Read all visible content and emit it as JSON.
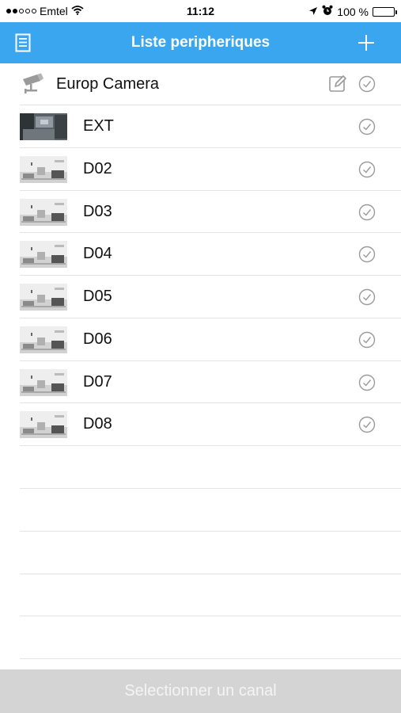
{
  "status_bar": {
    "carrier": "Emtel",
    "time": "11:12",
    "battery": "100 %",
    "signal_bars_filled": 2,
    "signal_bars_total": 5
  },
  "nav": {
    "title": "Liste peripheriques",
    "left_icon": "list-document-icon",
    "right_icon": "plus-icon",
    "color": "#3aa6f0"
  },
  "device": {
    "name": "Europ Camera",
    "icon": "cctv-camera-icon",
    "edit_icon": "edit-pencil-icon",
    "check_icon": "check-circle-icon"
  },
  "channels": [
    {
      "label": "EXT",
      "thumb": "dark"
    },
    {
      "label": "D02",
      "thumb": "light"
    },
    {
      "label": "D03",
      "thumb": "light"
    },
    {
      "label": "D04",
      "thumb": "light"
    },
    {
      "label": "D05",
      "thumb": "light"
    },
    {
      "label": "D06",
      "thumb": "light"
    },
    {
      "label": "D07",
      "thumb": "light"
    },
    {
      "label": "D08",
      "thumb": "light"
    }
  ],
  "bottom_button": {
    "label": "Selectionner un canal"
  }
}
